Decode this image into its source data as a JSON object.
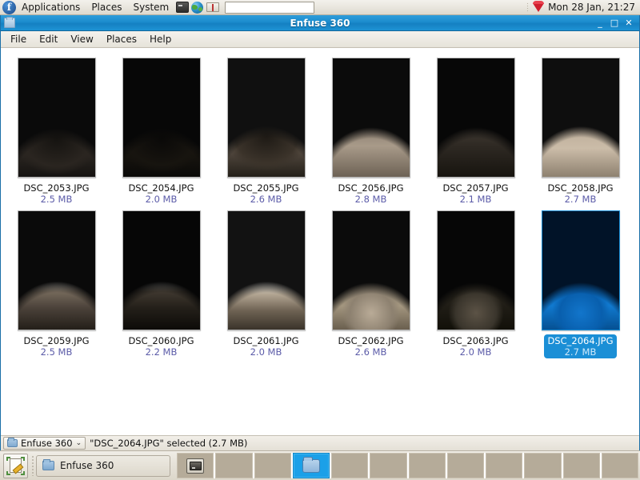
{
  "top_panel": {
    "logo_glyph": "f",
    "logo_name": "fedora-logo-icon",
    "menus": [
      {
        "label": "Applications",
        "name": "applications-menu"
      },
      {
        "label": "Places",
        "name": "places-menu"
      },
      {
        "label": "System",
        "name": "system-menu"
      }
    ],
    "launchers": [
      {
        "name": "terminal-icon",
        "title": "Terminal"
      },
      {
        "name": "web-browser-icon",
        "title": "Web Browser"
      },
      {
        "name": "dictionary-icon",
        "title": "Dictionary"
      }
    ],
    "search": {
      "value": "",
      "placeholder": ""
    },
    "tray_icon": "ruby-gem-icon",
    "clock": "Mon 28 Jan, 21:27"
  },
  "window": {
    "title": "Enfuse 360",
    "titlebar_icon": "folder-window-icon",
    "controls": {
      "minimize": "_",
      "maximize": "□",
      "close": "✕"
    },
    "menubar": [
      {
        "label": "File",
        "accel": "F",
        "name": "menu-file"
      },
      {
        "label": "Edit",
        "accel": "E",
        "name": "menu-edit"
      },
      {
        "label": "View",
        "accel": "V",
        "name": "menu-view"
      },
      {
        "label": "Places",
        "accel": "P",
        "name": "menu-places"
      },
      {
        "label": "Help",
        "accel": "H",
        "name": "menu-help"
      }
    ]
  },
  "files": [
    {
      "name": "DSC_2053.JPG",
      "size": "2.5 MB",
      "selected": false,
      "scene": "archway"
    },
    {
      "name": "DSC_2054.JPG",
      "size": "2.0 MB",
      "selected": false,
      "scene": "archway-dark"
    },
    {
      "name": "DSC_2055.JPG",
      "size": "2.6 MB",
      "selected": false,
      "scene": "archway-bright"
    },
    {
      "name": "DSC_2056.JPG",
      "size": "2.8 MB",
      "selected": false,
      "scene": "street-van"
    },
    {
      "name": "DSC_2057.JPG",
      "size": "2.1 MB",
      "selected": false,
      "scene": "street-dark"
    },
    {
      "name": "DSC_2058.JPG",
      "size": "2.7 MB",
      "selected": false,
      "scene": "street-bright"
    },
    {
      "name": "DSC_2059.JPG",
      "size": "2.5 MB",
      "selected": false,
      "scene": "square-sky"
    },
    {
      "name": "DSC_2060.JPG",
      "size": "2.2 MB",
      "selected": false,
      "scene": "square-dark"
    },
    {
      "name": "DSC_2061.JPG",
      "size": "2.0 MB",
      "selected": false,
      "scene": "square-bright"
    },
    {
      "name": "DSC_2062.JPG",
      "size": "2.6 MB",
      "selected": false,
      "scene": "pavement"
    },
    {
      "name": "DSC_2063.JPG",
      "size": "2.0 MB",
      "selected": false,
      "scene": "pavement-dark"
    },
    {
      "name": "DSC_2064.JPG",
      "size": "2.7 MB",
      "selected": true,
      "scene": "pavement-blue"
    }
  ],
  "statusbar": {
    "path_button": "Enfuse 360",
    "path_chevron": "⌄",
    "text": "\"DSC_2064.JPG\" selected (2.7 MB)"
  },
  "bottom_panel": {
    "show_desktop_icon": "show-desktop-icon",
    "task_button": {
      "label": "Enfuse 360",
      "icon": "folder-icon"
    },
    "workspaces": [
      {
        "index": 1,
        "active": false,
        "content": "monitor"
      },
      {
        "index": 2,
        "active": false,
        "content": ""
      },
      {
        "index": 3,
        "active": false,
        "content": ""
      },
      {
        "index": 4,
        "active": true,
        "content": "folder"
      },
      {
        "index": 5,
        "active": false,
        "content": ""
      },
      {
        "index": 6,
        "active": false,
        "content": ""
      },
      {
        "index": 7,
        "active": false,
        "content": ""
      },
      {
        "index": 8,
        "active": false,
        "content": ""
      },
      {
        "index": 9,
        "active": false,
        "content": ""
      },
      {
        "index": 10,
        "active": false,
        "content": ""
      },
      {
        "index": 11,
        "active": false,
        "content": ""
      },
      {
        "index": 12,
        "active": false,
        "content": ""
      }
    ]
  },
  "colors": {
    "titlebar_blue": "#1b8ccd",
    "selection_blue": "#1b8fd6",
    "filesize_purple": "#5b5ba8",
    "panel_bg": "#e8e5dd",
    "workspace_cell": "#b5ab99",
    "workspace_active": "#1ba0e8"
  }
}
